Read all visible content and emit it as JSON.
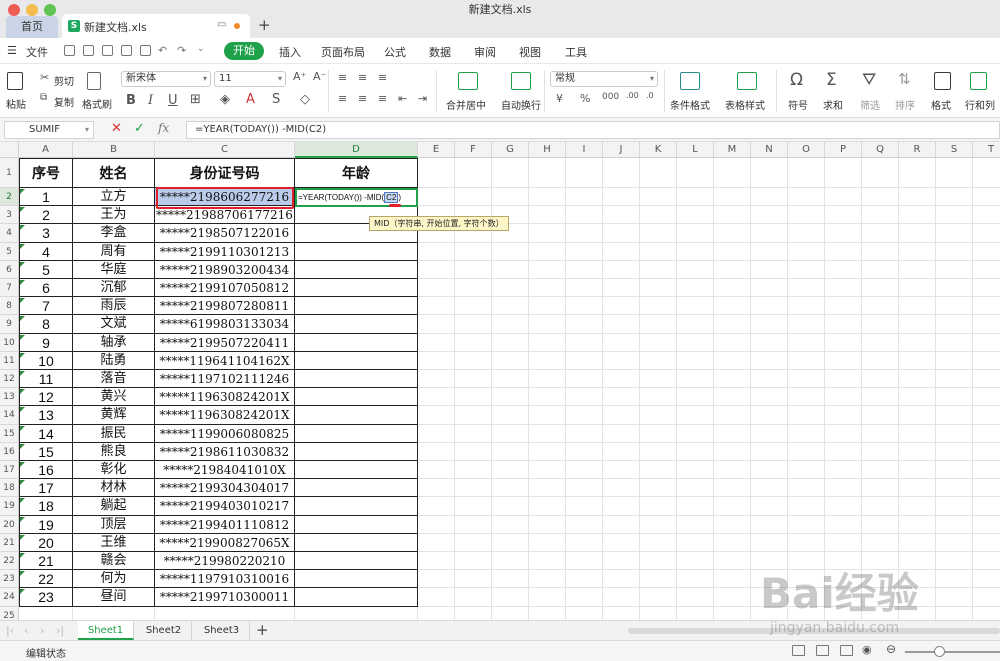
{
  "window": {
    "title": "新建文档.xls"
  },
  "tabs": {
    "home": "首页",
    "doc": "新建文档.xls",
    "add": "+"
  },
  "menu": {
    "file": "文件",
    "items": [
      "开始",
      "插入",
      "页面布局",
      "公式",
      "数据",
      "审阅",
      "视图",
      "工具"
    ]
  },
  "ribbon": {
    "paste": "粘贴",
    "cut": "剪切",
    "copy": "复制",
    "format_painter": "格式刷",
    "font_name": "新宋体",
    "font_size": "11",
    "merge": "合并居中",
    "wrap": "自动换行",
    "number_format": "常规",
    "cond_format": "条件格式",
    "table_style": "表格样式",
    "symbol": "符号",
    "sum": "求和",
    "filter": "筛选",
    "sort": "排序",
    "format": "格式",
    "row_col": "行和列"
  },
  "formula_bar": {
    "name_box": "SUMIF",
    "formula": "=YEAR(TODAY()) -MID(C2)"
  },
  "grid": {
    "columns": [
      "A",
      "B",
      "C",
      "D",
      "E",
      "F",
      "G",
      "H",
      "I",
      "J",
      "K",
      "L",
      "M",
      "N",
      "O",
      "P",
      "Q",
      "R",
      "S",
      "T"
    ],
    "headers": [
      "序号",
      "姓名",
      "身份证号码",
      "年龄"
    ],
    "rows": [
      [
        "1",
        "立方",
        "*****2198606277216"
      ],
      [
        "2",
        "王为",
        "*****21988706177216"
      ],
      [
        "3",
        "李盒",
        "*****2198507122016"
      ],
      [
        "4",
        "周有",
        "*****2199110301213"
      ],
      [
        "5",
        "华庭",
        "*****2198903200434"
      ],
      [
        "6",
        "沉郁",
        "*****2199107050812"
      ],
      [
        "7",
        "雨辰",
        "*****2199807280811"
      ],
      [
        "8",
        "文斌",
        "*****6199803133034"
      ],
      [
        "9",
        "轴承",
        "*****2199507220411"
      ],
      [
        "10",
        "陆勇",
        "*****119641104162X"
      ],
      [
        "11",
        "落音",
        "*****1197102111246"
      ],
      [
        "12",
        "黄兴",
        "*****119630824201X"
      ],
      [
        "13",
        "黄辉",
        "*****119630824201X"
      ],
      [
        "14",
        "振民",
        "*****1199006080825"
      ],
      [
        "15",
        "熊良",
        "*****2198611030832"
      ],
      [
        "16",
        "彰化",
        "*****21984041010X"
      ],
      [
        "17",
        "材林",
        "*****2199304304017"
      ],
      [
        "18",
        "躺起",
        "*****2199403010217"
      ],
      [
        "19",
        "顶层",
        "*****2199401110812"
      ],
      [
        "20",
        "王维",
        "*****219900827065X"
      ],
      [
        "21",
        "赣会",
        "*****219980220210"
      ],
      [
        "22",
        "何为",
        "*****1197910310016"
      ],
      [
        "23",
        "昼间",
        "*****2199710300011"
      ]
    ],
    "active_formula_prefix": "=YEAR(TODAY()) -MID(",
    "active_formula_ref": "C2",
    "active_formula_suffix": ")",
    "tooltip_fn": "MID",
    "tooltip_args": "（字符串, 开始位置, 字符个数）"
  },
  "sheets": [
    "Sheet1",
    "Sheet2",
    "Sheet3"
  ],
  "status": {
    "mode": "编辑状态"
  },
  "watermark": {
    "brand": "Bai经验",
    "url": "jingyan.baidu.com"
  }
}
